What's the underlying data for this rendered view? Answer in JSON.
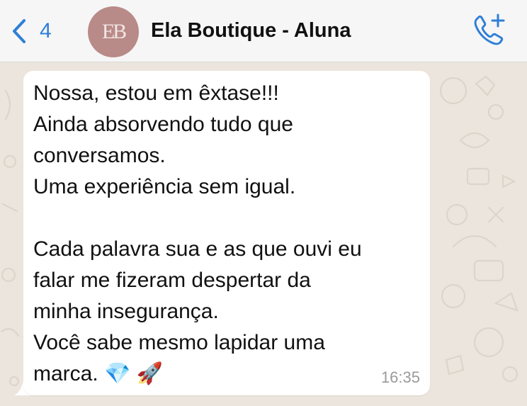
{
  "header": {
    "back_count": "4",
    "avatar_initials": "EB",
    "title": "Ela Boutique - Aluna"
  },
  "colors": {
    "accent": "#2f7fd6",
    "header_bg": "#f6f6f6",
    "chat_bg": "#ece5dd",
    "bubble_bg": "#ffffff",
    "avatar_bg": "#b88a88"
  },
  "icons": {
    "back": "chevron-left-icon",
    "call": "phone-add-icon"
  },
  "message": {
    "text": "Nossa, estou em êxtase!!!\nAinda absorvendo tudo que\nconversamos.\nUma experiência sem igual.\n\nCada palavra sua e as que ouvi eu\nfalar me fizeram despertar da\nminha insegurança.\nVocê sabe mesmo lapidar uma\nmarca. 💎 🚀",
    "time": "16:35"
  }
}
